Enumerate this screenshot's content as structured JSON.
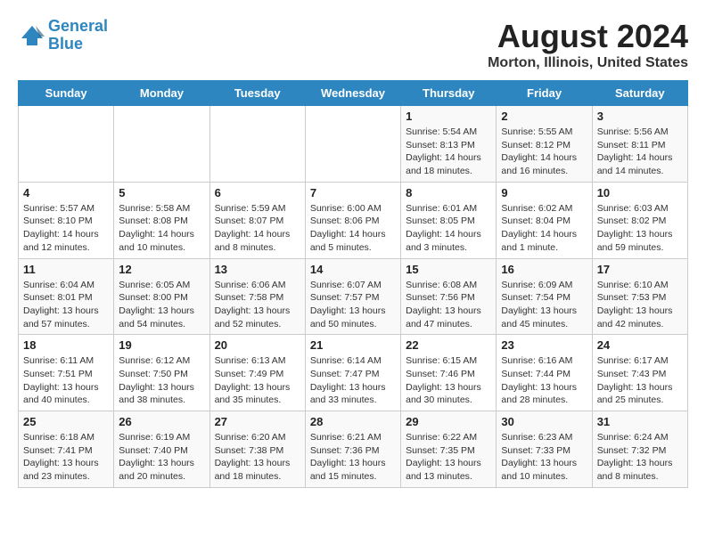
{
  "logo": {
    "line1": "General",
    "line2": "Blue"
  },
  "title": "August 2024",
  "subtitle": "Morton, Illinois, United States",
  "days_of_week": [
    "Sunday",
    "Monday",
    "Tuesday",
    "Wednesday",
    "Thursday",
    "Friday",
    "Saturday"
  ],
  "weeks": [
    [
      {
        "day": "",
        "info": ""
      },
      {
        "day": "",
        "info": ""
      },
      {
        "day": "",
        "info": ""
      },
      {
        "day": "",
        "info": ""
      },
      {
        "day": "1",
        "info": "Sunrise: 5:54 AM\nSunset: 8:13 PM\nDaylight: 14 hours\nand 18 minutes."
      },
      {
        "day": "2",
        "info": "Sunrise: 5:55 AM\nSunset: 8:12 PM\nDaylight: 14 hours\nand 16 minutes."
      },
      {
        "day": "3",
        "info": "Sunrise: 5:56 AM\nSunset: 8:11 PM\nDaylight: 14 hours\nand 14 minutes."
      }
    ],
    [
      {
        "day": "4",
        "info": "Sunrise: 5:57 AM\nSunset: 8:10 PM\nDaylight: 14 hours\nand 12 minutes."
      },
      {
        "day": "5",
        "info": "Sunrise: 5:58 AM\nSunset: 8:08 PM\nDaylight: 14 hours\nand 10 minutes."
      },
      {
        "day": "6",
        "info": "Sunrise: 5:59 AM\nSunset: 8:07 PM\nDaylight: 14 hours\nand 8 minutes."
      },
      {
        "day": "7",
        "info": "Sunrise: 6:00 AM\nSunset: 8:06 PM\nDaylight: 14 hours\nand 5 minutes."
      },
      {
        "day": "8",
        "info": "Sunrise: 6:01 AM\nSunset: 8:05 PM\nDaylight: 14 hours\nand 3 minutes."
      },
      {
        "day": "9",
        "info": "Sunrise: 6:02 AM\nSunset: 8:04 PM\nDaylight: 14 hours\nand 1 minute."
      },
      {
        "day": "10",
        "info": "Sunrise: 6:03 AM\nSunset: 8:02 PM\nDaylight: 13 hours\nand 59 minutes."
      }
    ],
    [
      {
        "day": "11",
        "info": "Sunrise: 6:04 AM\nSunset: 8:01 PM\nDaylight: 13 hours\nand 57 minutes."
      },
      {
        "day": "12",
        "info": "Sunrise: 6:05 AM\nSunset: 8:00 PM\nDaylight: 13 hours\nand 54 minutes."
      },
      {
        "day": "13",
        "info": "Sunrise: 6:06 AM\nSunset: 7:58 PM\nDaylight: 13 hours\nand 52 minutes."
      },
      {
        "day": "14",
        "info": "Sunrise: 6:07 AM\nSunset: 7:57 PM\nDaylight: 13 hours\nand 50 minutes."
      },
      {
        "day": "15",
        "info": "Sunrise: 6:08 AM\nSunset: 7:56 PM\nDaylight: 13 hours\nand 47 minutes."
      },
      {
        "day": "16",
        "info": "Sunrise: 6:09 AM\nSunset: 7:54 PM\nDaylight: 13 hours\nand 45 minutes."
      },
      {
        "day": "17",
        "info": "Sunrise: 6:10 AM\nSunset: 7:53 PM\nDaylight: 13 hours\nand 42 minutes."
      }
    ],
    [
      {
        "day": "18",
        "info": "Sunrise: 6:11 AM\nSunset: 7:51 PM\nDaylight: 13 hours\nand 40 minutes."
      },
      {
        "day": "19",
        "info": "Sunrise: 6:12 AM\nSunset: 7:50 PM\nDaylight: 13 hours\nand 38 minutes."
      },
      {
        "day": "20",
        "info": "Sunrise: 6:13 AM\nSunset: 7:49 PM\nDaylight: 13 hours\nand 35 minutes."
      },
      {
        "day": "21",
        "info": "Sunrise: 6:14 AM\nSunset: 7:47 PM\nDaylight: 13 hours\nand 33 minutes."
      },
      {
        "day": "22",
        "info": "Sunrise: 6:15 AM\nSunset: 7:46 PM\nDaylight: 13 hours\nand 30 minutes."
      },
      {
        "day": "23",
        "info": "Sunrise: 6:16 AM\nSunset: 7:44 PM\nDaylight: 13 hours\nand 28 minutes."
      },
      {
        "day": "24",
        "info": "Sunrise: 6:17 AM\nSunset: 7:43 PM\nDaylight: 13 hours\nand 25 minutes."
      }
    ],
    [
      {
        "day": "25",
        "info": "Sunrise: 6:18 AM\nSunset: 7:41 PM\nDaylight: 13 hours\nand 23 minutes."
      },
      {
        "day": "26",
        "info": "Sunrise: 6:19 AM\nSunset: 7:40 PM\nDaylight: 13 hours\nand 20 minutes."
      },
      {
        "day": "27",
        "info": "Sunrise: 6:20 AM\nSunset: 7:38 PM\nDaylight: 13 hours\nand 18 minutes."
      },
      {
        "day": "28",
        "info": "Sunrise: 6:21 AM\nSunset: 7:36 PM\nDaylight: 13 hours\nand 15 minutes."
      },
      {
        "day": "29",
        "info": "Sunrise: 6:22 AM\nSunset: 7:35 PM\nDaylight: 13 hours\nand 13 minutes."
      },
      {
        "day": "30",
        "info": "Sunrise: 6:23 AM\nSunset: 7:33 PM\nDaylight: 13 hours\nand 10 minutes."
      },
      {
        "day": "31",
        "info": "Sunrise: 6:24 AM\nSunset: 7:32 PM\nDaylight: 13 hours\nand 8 minutes."
      }
    ]
  ]
}
